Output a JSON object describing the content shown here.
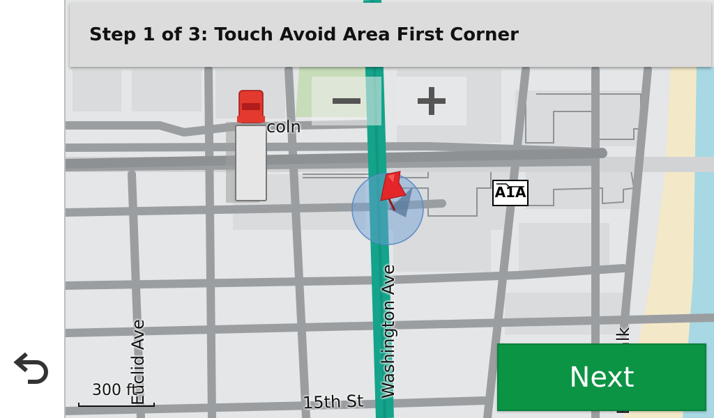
{
  "banner": {
    "title": "Step 1 of 3: Touch Avoid Area First Corner"
  },
  "controls": {
    "zoom_out_icon": "minus-icon",
    "zoom_in_icon": "plus-icon",
    "back_icon": "undo-arrow-icon",
    "next_label": "Next"
  },
  "map": {
    "streets": {
      "lincoln": "coln",
      "euclid": "Euclid Ave",
      "washington": "Washington Ave",
      "fifteenth": "15th St",
      "boardwalk": "Boardwalk"
    },
    "highway_shield": "A1A",
    "scale": "300 ft",
    "colors": {
      "route": "#14a38b",
      "pin": "#e3262a",
      "truck": "#e23a2e",
      "accuracy_circle": "#6e9fd8",
      "next_button": "#0b9444",
      "park": "#c7dcb8",
      "beach": "#f3e9c8",
      "water": "#9fd6e2"
    }
  }
}
